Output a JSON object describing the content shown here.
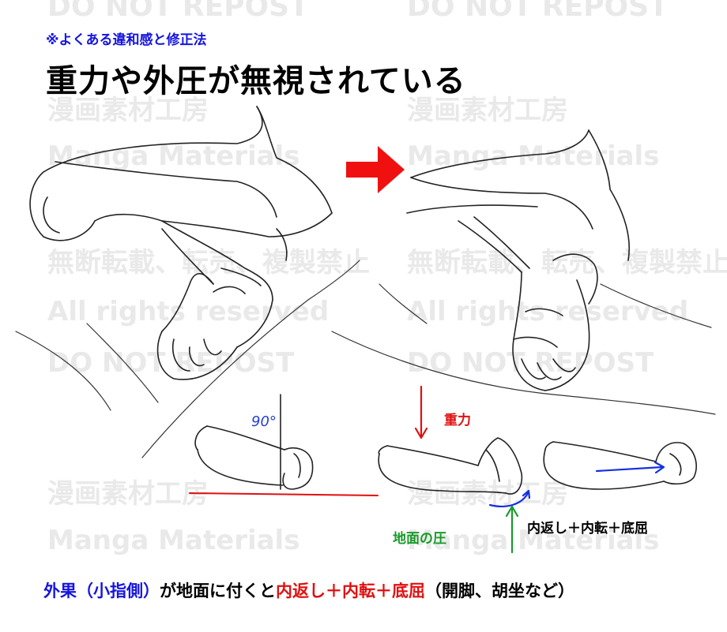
{
  "header": {
    "subtitle": "※よくある違和感と修正法",
    "title": "重力や外圧が無視されている"
  },
  "watermarks": {
    "top": "DO NOT REPOST",
    "jp": "漫画素材工房",
    "en": "Manga Materials",
    "ban": "無断転載、転売、複製禁止",
    "rights": "All rights reserved",
    "repost": "DO NOT REPOST"
  },
  "annotations": {
    "angle": "90°",
    "gravity": "重力",
    "ground_pressure": "地面の圧",
    "result": "内返し＋内転＋底屈"
  },
  "footer": {
    "part1": "外果（小指側）",
    "part2": "が地面に付くと",
    "part3": "内返し＋内転＋底屈",
    "part4": "（開脚、胡坐など）"
  },
  "colors": {
    "blue": "#1515e0",
    "red": "#e01010",
    "green": "#1a9a2a",
    "watermark": "#e9e9e9"
  }
}
